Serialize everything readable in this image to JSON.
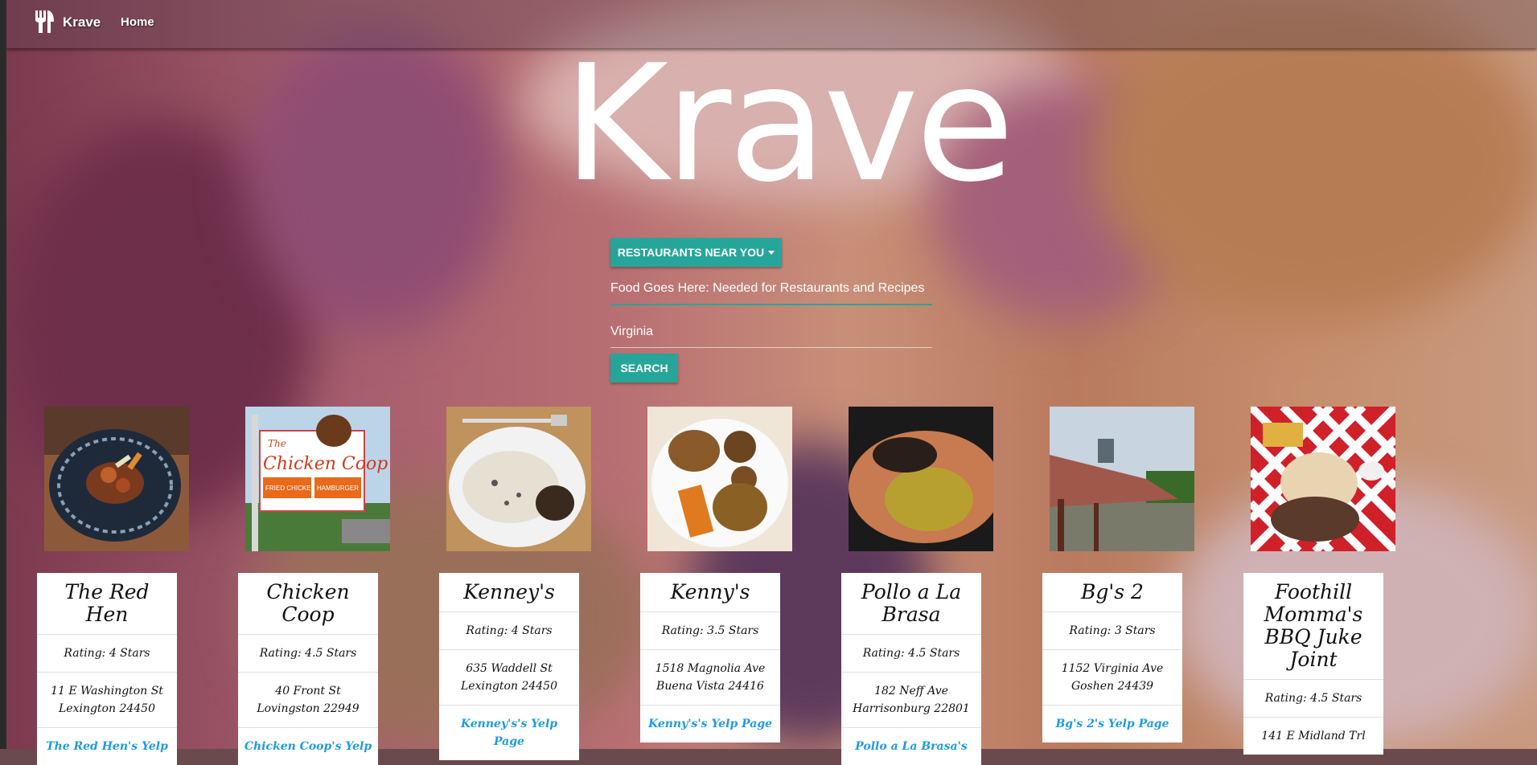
{
  "nav": {
    "brand": "Krave",
    "home": "Home"
  },
  "hero": {
    "title": "Krave"
  },
  "search": {
    "dropdown_label": "RESTAURANTS NEAR YOU",
    "food_placeholder": "Food Goes Here: Needed for Restaurants and Recipes",
    "location_value": "Virginia",
    "search_label": "SEARCH"
  },
  "restaurants": [
    {
      "name": "The Red Hen",
      "rating": "Rating: 4 Stars",
      "address1": "11 E Washington St",
      "address2": "Lexington 24450",
      "link": "The Red Hen's Yelp"
    },
    {
      "name": "Chicken Coop",
      "rating": "Rating: 4.5 Stars",
      "address1": "40 Front St",
      "address2": "Lovingston 22949",
      "link": "Chicken Coop's Yelp"
    },
    {
      "name": "Kenney's",
      "rating": "Rating: 4 Stars",
      "address1": "635 Waddell St",
      "address2": "Lexington 24450",
      "link": "Kenney's's Yelp Page"
    },
    {
      "name": "Kenny's",
      "rating": "Rating: 3.5 Stars",
      "address1": "1518 Magnolia Ave",
      "address2": "Buena Vista 24416",
      "link": "Kenny's's Yelp Page"
    },
    {
      "name": "Pollo a La Brasa",
      "rating": "Rating: 4.5 Stars",
      "address1": "182 Neff Ave",
      "address2": "Harrisonburg 22801",
      "link": "Pollo a La Brasa's"
    },
    {
      "name": "Bg's 2",
      "rating": "Rating: 3 Stars",
      "address1": "1152 Virginia Ave",
      "address2": "Goshen 24439",
      "link": "Bg's 2's Yelp Page"
    },
    {
      "name": "Foothill Momma's BBQ Juke Joint",
      "rating": "Rating: 4.5 Stars",
      "address1": "141 E Midland Trl",
      "address2": "",
      "link": ""
    }
  ],
  "photo_sign": {
    "top": "The",
    "name": "Chicken Coop",
    "left": "FRIED CHICKEN",
    "right": "HAMBURGER"
  },
  "colors": {
    "accent": "#26a69a",
    "link": "#1e9be0"
  }
}
